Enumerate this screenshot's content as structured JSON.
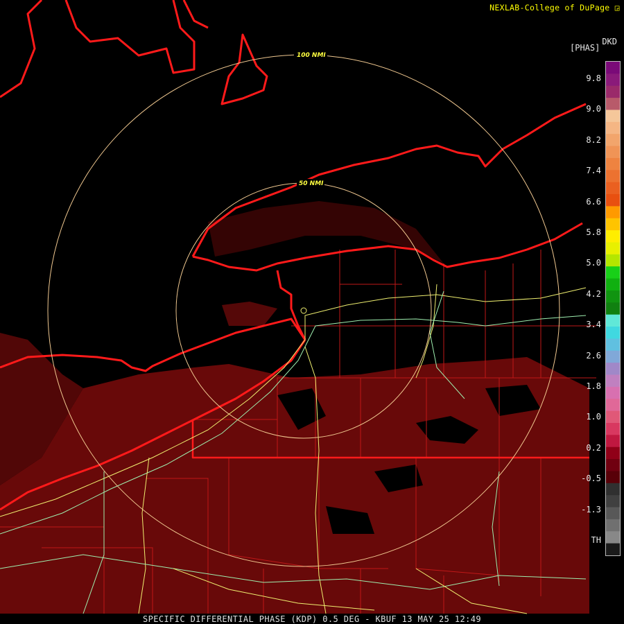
{
  "header": {
    "credit": "NEXLAB-College of DuPage",
    "credit_icon": "resize-corner-icon",
    "product_code": "DKD",
    "unit_label": "[PHAS]"
  },
  "range_rings": [
    {
      "label": "100 NMI"
    },
    {
      "label": "50 NMI"
    }
  ],
  "legend": {
    "ticks": [
      "9.8",
      "9.0",
      "8.2",
      "7.4",
      "6.6",
      "5.8",
      "5.0",
      "4.2",
      "3.4",
      "2.6",
      "1.8",
      "1.0",
      "0.2",
      "-0.5",
      "-1.3",
      "TH"
    ],
    "colors": [
      "#7a0a78",
      "#8a1a7a",
      "#9a2a6a",
      "#b85a6a",
      "#f5c79a",
      "#f5b684",
      "#f2a56c",
      "#f09456",
      "#ee8340",
      "#ec7230",
      "#ea6020",
      "#e85010",
      "#ff9a00",
      "#ffc400",
      "#ffee00",
      "#e8f000",
      "#b4e600",
      "#18d018",
      "#10b010",
      "#109410",
      "#108010",
      "#60e8d8",
      "#40d8e0",
      "#60c0e0",
      "#80a8d8",
      "#a088c8",
      "#c080c0",
      "#d870b0",
      "#e06898",
      "#e05878",
      "#d83860",
      "#c01840",
      "#900018",
      "#700010",
      "#580008",
      "#303030",
      "#404040",
      "#585858",
      "#707070",
      "#888888",
      "#1a1a1a"
    ],
    "accent_reflectivity": "#6e0a0a"
  },
  "footer": {
    "product_line": "SPECIFIC DIFFERENTIAL PHASE (KDP) 0.5 DEG - KBUF 13 MAY 25 12:49"
  },
  "colors": {
    "shoreline": "#ff1a1a",
    "county": "#c01818",
    "highway_yellow": "#f0f070",
    "highway_green": "#9ff0b0",
    "ring": "#f0c890",
    "echo": "#6e0a0a"
  }
}
